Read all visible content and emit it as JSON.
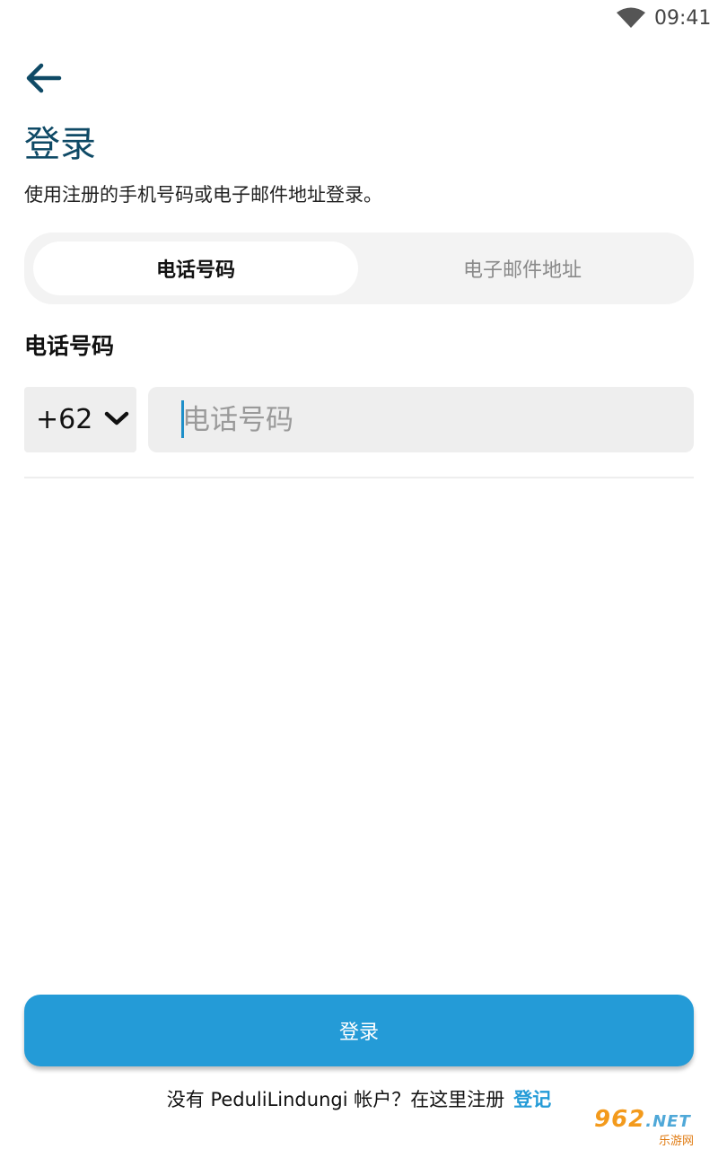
{
  "status_bar": {
    "time": "09:41",
    "wifi_icon": "wifi-icon"
  },
  "header": {
    "back_icon": "arrow-left-icon",
    "title": "登录",
    "subtitle": "使用注册的手机号码或电子邮件地址登录。"
  },
  "tabs": [
    {
      "label": "电话号码",
      "active": true
    },
    {
      "label": "电子邮件地址",
      "active": false
    }
  ],
  "form": {
    "field_label": "电话号码",
    "country_code": "+62",
    "dropdown_icon": "chevron-down-icon",
    "phone_value": "",
    "phone_placeholder": "电话号码"
  },
  "login_button": {
    "label": "登录"
  },
  "footer": {
    "text": "没有 PeduliLindungi 帐户？在这里注册",
    "link": "登记"
  },
  "watermark": {
    "brand": "962",
    "domain": ".NET",
    "subtext": "乐游网"
  },
  "colors": {
    "primary": "#249bd7",
    "title": "#0f4a66",
    "field_bg": "#eeeeee",
    "tab_bg": "#f3f3f3"
  }
}
